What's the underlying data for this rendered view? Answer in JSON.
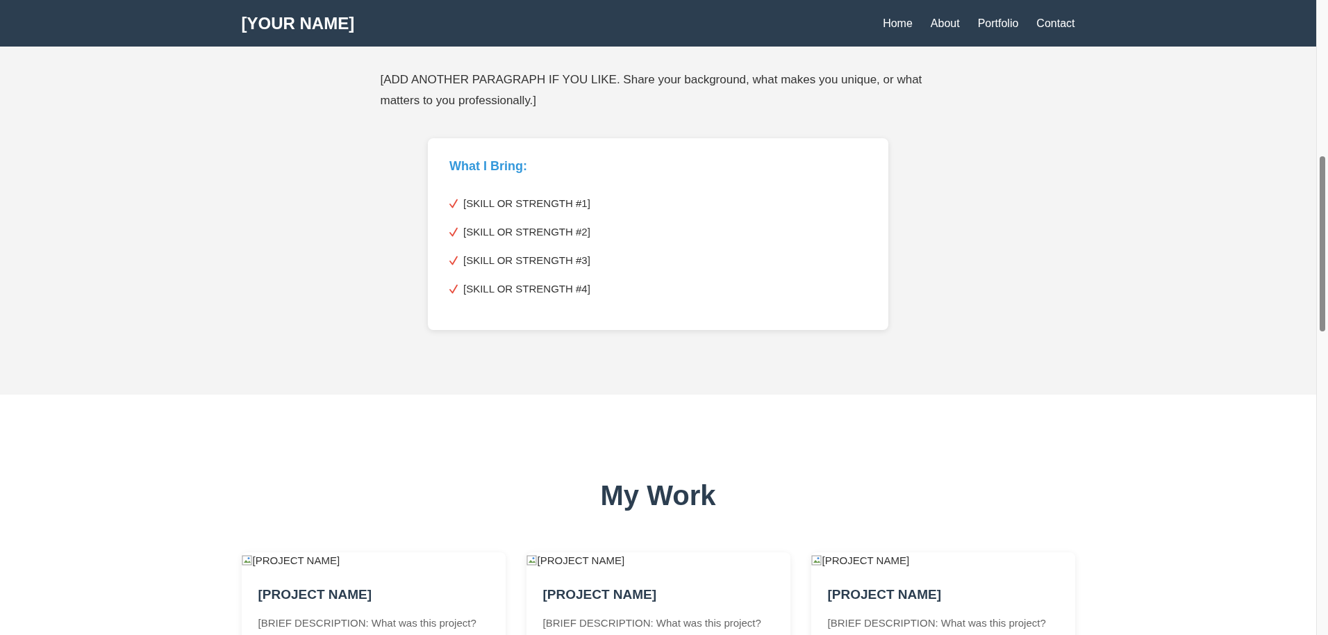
{
  "navbar": {
    "brand": "[YOUR NAME]",
    "links": [
      {
        "label": "Home"
      },
      {
        "label": "About"
      },
      {
        "label": "Portfolio"
      },
      {
        "label": "Contact"
      }
    ]
  },
  "about": {
    "paragraph": "[ADD ANOTHER PARAGRAPH IF YOU LIKE. Share your background, what makes you unique, or what matters to you professionally.]",
    "highlights": {
      "title": "What I Bring:",
      "items": [
        {
          "text": "[SKILL OR STRENGTH #1]"
        },
        {
          "text": "[SKILL OR STRENGTH #2]"
        },
        {
          "text": "[SKILL OR STRENGTH #3]"
        },
        {
          "text": "[SKILL OR STRENGTH #4]"
        }
      ]
    }
  },
  "work": {
    "title": "My Work",
    "projects": [
      {
        "image_alt": "[PROJECT NAME]",
        "name": "[PROJECT NAME]",
        "description": "[BRIEF DESCRIPTION: What was this project?"
      },
      {
        "image_alt": "[PROJECT NAME]",
        "name": "[PROJECT NAME]",
        "description": "[BRIEF DESCRIPTION: What was this project?"
      },
      {
        "image_alt": "[PROJECT NAME]",
        "name": "[PROJECT NAME]",
        "description": "[BRIEF DESCRIPTION: What was this project?"
      }
    ]
  }
}
